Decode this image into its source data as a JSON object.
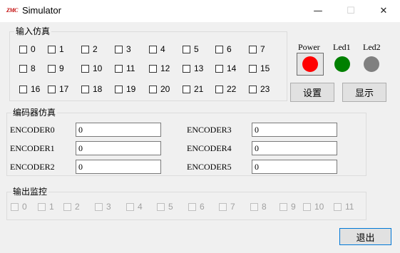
{
  "window": {
    "app_icon_text": "ZMC",
    "title": "Simulator",
    "minimize_glyph": "—",
    "maximize_glyph": "☐",
    "close_glyph": "✕"
  },
  "input_group": {
    "legend": "输入仿真",
    "checkboxes": [
      "0",
      "1",
      "2",
      "3",
      "4",
      "5",
      "6",
      "7",
      "8",
      "9",
      "10",
      "11",
      "12",
      "13",
      "14",
      "15",
      "16",
      "17",
      "18",
      "19",
      "20",
      "21",
      "22",
      "23"
    ]
  },
  "indicators": {
    "power_label": "Power",
    "led1_label": "Led1",
    "led2_label": "Led2",
    "power_color": "#ff0000",
    "led1_color": "#008000",
    "led2_color": "#808080"
  },
  "buttons": {
    "settings": "设置",
    "display": "显示",
    "exit": "退出"
  },
  "encoder_group": {
    "legend": "编码器仿真",
    "encoders": [
      {
        "label": "ENCODER0",
        "value": "0"
      },
      {
        "label": "ENCODER1",
        "value": "0"
      },
      {
        "label": "ENCODER2",
        "value": "0"
      },
      {
        "label": "ENCODER3",
        "value": "0"
      },
      {
        "label": "ENCODER4",
        "value": "0"
      },
      {
        "label": "ENCODER5",
        "value": "0"
      }
    ]
  },
  "output_group": {
    "legend": "输出监控",
    "checkboxes": [
      "0",
      "1",
      "2",
      "3",
      "4",
      "5",
      "6",
      "7",
      "8",
      "9",
      "10",
      "11"
    ]
  }
}
